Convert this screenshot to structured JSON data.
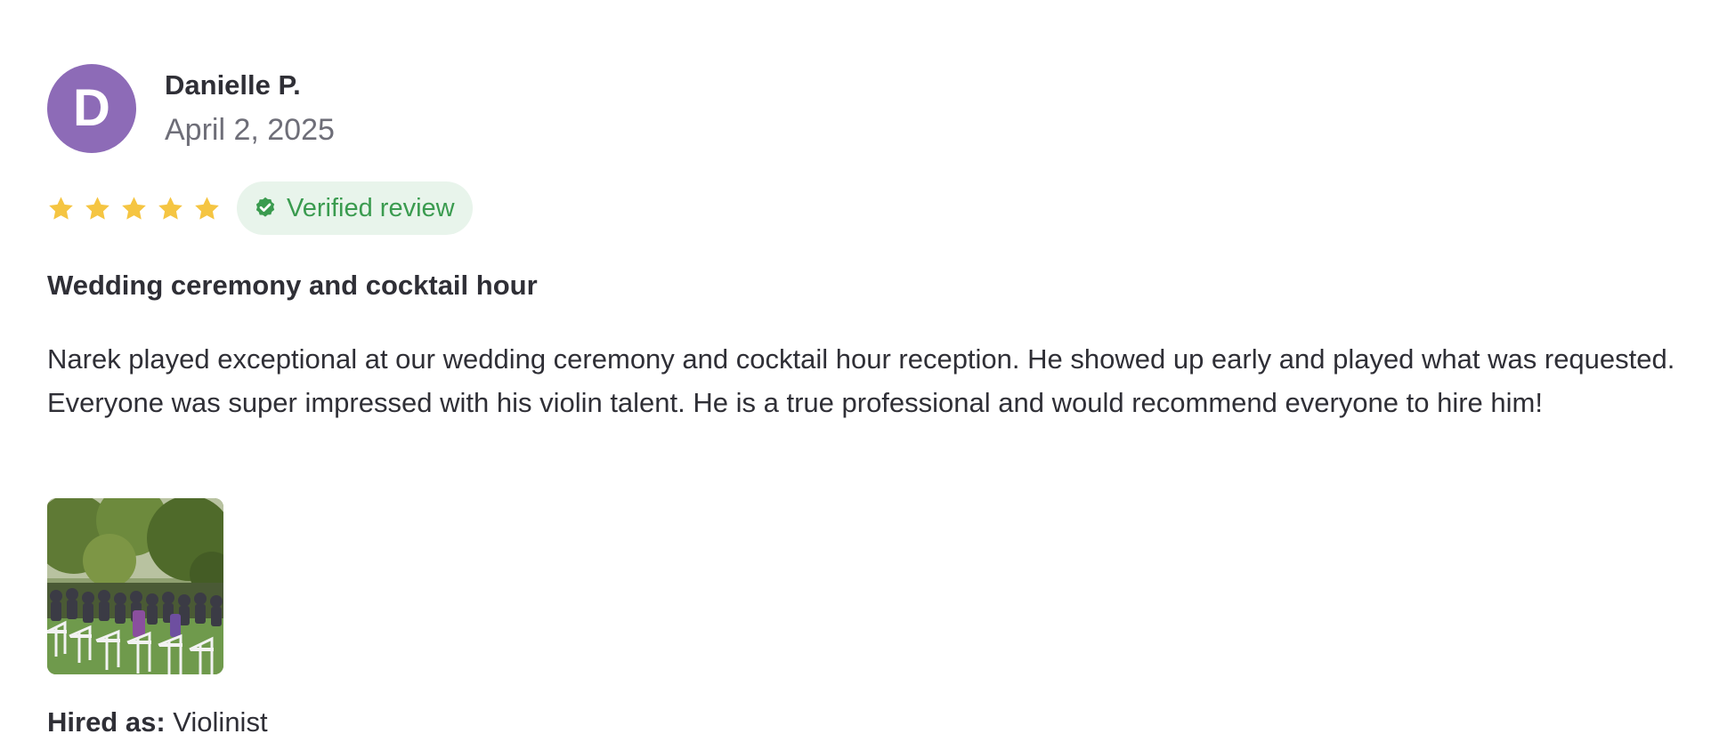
{
  "reviewer": {
    "initial": "D",
    "name": "Danielle P.",
    "date": "April 2, 2025",
    "avatar_color": "#8d6bb7"
  },
  "rating": {
    "stars": 5,
    "max": 5,
    "star_color": "#f5c542",
    "star_icon": "star-icon"
  },
  "verified_badge": {
    "label": "Verified review",
    "icon": "verified-check-icon",
    "text_color": "#3a9b4f",
    "background": "#e8f4eb"
  },
  "review": {
    "title": "Wedding ceremony and cocktail hour",
    "body": "Narek played exceptional at our wedding ceremony and cocktail hour reception. He showed up early and played what was requested. Everyone was super impressed with his violin talent. He is a true professional and would recommend everyone to hire him!"
  },
  "photo": {
    "description_icon": "review-photo-thumbnail"
  },
  "hired_as": {
    "label": "Hired as:",
    "value": "Violinist"
  }
}
